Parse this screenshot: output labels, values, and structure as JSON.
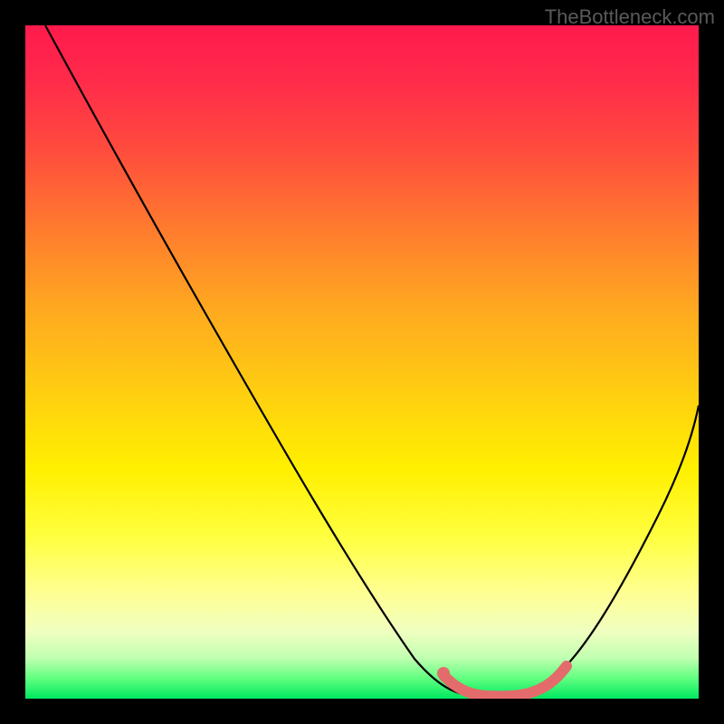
{
  "watermark": "TheBottleneck.com",
  "colors": {
    "background": "#000000",
    "gradient_top": "#ff1a4d",
    "gradient_bottom": "#00e860",
    "curve": "#000000",
    "highlight": "#e46b6b"
  },
  "chart_data": {
    "type": "line",
    "title": "",
    "xlabel": "",
    "ylabel": "",
    "xlim": [
      0,
      100
    ],
    "ylim": [
      0,
      100
    ],
    "grid": false,
    "annotations": [
      "TheBottleneck.com"
    ],
    "series": [
      {
        "name": "bottleneck-curve",
        "x": [
          3,
          10,
          20,
          30,
          40,
          50,
          55,
          60,
          65,
          70,
          75,
          80,
          85,
          90,
          95,
          100
        ],
        "y": [
          100,
          88,
          72,
          56,
          40,
          24,
          15,
          7,
          2,
          0,
          0,
          4,
          12,
          24,
          38,
          55
        ]
      }
    ],
    "highlight_segment": {
      "name": "optimal-range",
      "x": [
        63,
        66,
        70,
        74,
        78,
        80
      ],
      "y": [
        3,
        1,
        0,
        0,
        2,
        4
      ]
    }
  }
}
